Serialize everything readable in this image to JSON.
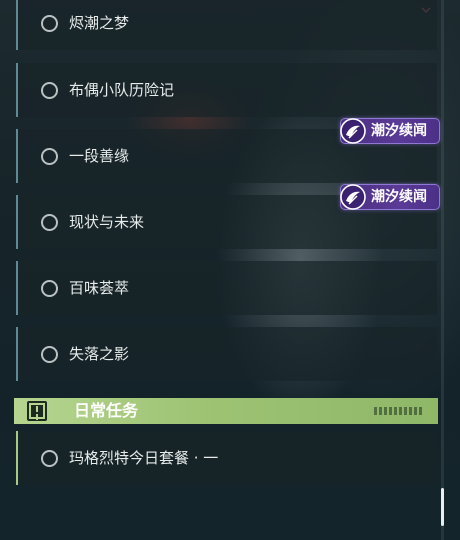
{
  "quests": [
    {
      "title": "烬潮之梦"
    },
    {
      "title": "布偶小队历险记"
    },
    {
      "title": "一段善缘",
      "badge": "潮汐续闻"
    },
    {
      "title": "现状与未来",
      "badge": "潮汐续闻"
    },
    {
      "title": "百味荟萃"
    },
    {
      "title": "失落之影"
    }
  ],
  "daily_section": {
    "title": "日常任务",
    "icon": "exclamation-square-icon",
    "accent": "#a8c982"
  },
  "daily_quests": [
    {
      "title": "玛格烈特今日套餐 · 一"
    }
  ],
  "colors": {
    "badge_bg": "#5a3a96",
    "row_accent": "#5f8995"
  }
}
